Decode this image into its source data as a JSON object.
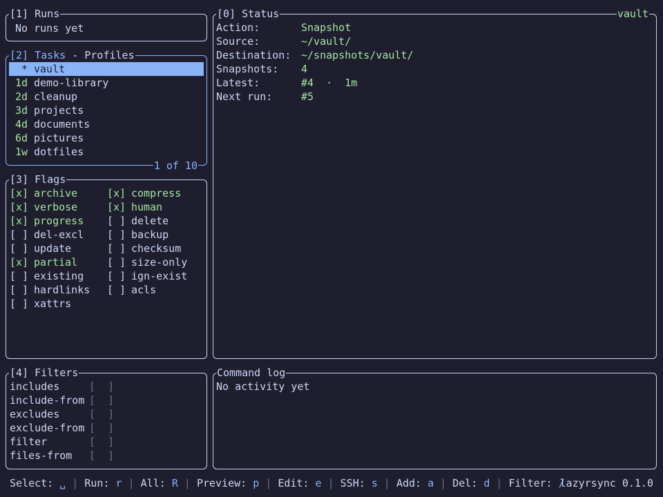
{
  "runs": {
    "title_num": "[1]",
    "title": " Runs",
    "empty": "No runs yet"
  },
  "tasks": {
    "title_num": "[2]",
    "title": " Tasks",
    "subtitle": " - Profiles",
    "items": [
      {
        "marker": "*",
        "name": "vault",
        "selected": true
      },
      {
        "marker": "1d",
        "name": "demo-library"
      },
      {
        "marker": "2d",
        "name": "cleanup"
      },
      {
        "marker": "3d",
        "name": "projects"
      },
      {
        "marker": "4d",
        "name": "documents"
      },
      {
        "marker": "6d",
        "name": "pictures"
      },
      {
        "marker": "1w",
        "name": "dotfiles"
      }
    ],
    "position": "1 of 10"
  },
  "flags": {
    "title_num": "[3]",
    "title": " Flags",
    "on_box": "[x]",
    "off_box": "[ ]",
    "rows": [
      [
        {
          "name": "archive",
          "on": true
        },
        {
          "name": "compress",
          "on": true
        }
      ],
      [
        {
          "name": "verbose",
          "on": true
        },
        {
          "name": "human",
          "on": true
        }
      ],
      [
        {
          "name": "progress",
          "on": true
        },
        {
          "name": "delete",
          "on": false
        }
      ],
      [
        {
          "name": "del-excl",
          "on": false
        },
        {
          "name": "backup",
          "on": false
        }
      ],
      [
        {
          "name": "update",
          "on": false
        },
        {
          "name": "checksum",
          "on": false
        }
      ],
      [
        {
          "name": "partial",
          "on": true
        },
        {
          "name": "size-only",
          "on": false
        }
      ],
      [
        {
          "name": "existing",
          "on": false
        },
        {
          "name": "ign-exist",
          "on": false
        }
      ],
      [
        {
          "name": "hardlinks",
          "on": false
        },
        {
          "name": "acls",
          "on": false
        }
      ],
      [
        {
          "name": "xattrs",
          "on": false
        }
      ]
    ]
  },
  "status": {
    "title": "[0] Status",
    "profile": "vault",
    "rows": [
      {
        "key": "Action:",
        "value": "Snapshot"
      },
      {
        "key": "Source:",
        "value": "~/vault/"
      },
      {
        "key": "Destination:",
        "value": "~/snapshots/vault/"
      },
      {
        "key": "Snapshots:",
        "value": "4"
      },
      {
        "key": "Latest:",
        "value": "#4  ·  1m"
      },
      {
        "key": "Next run:",
        "value": "#5"
      }
    ]
  },
  "filters": {
    "title": "[4] Filters",
    "empty_box": "[  ]",
    "items": [
      "includes",
      "include-from",
      "excludes",
      "exclude-from",
      "filter",
      "files-from"
    ]
  },
  "cmdlog": {
    "title": "Command log",
    "empty": "No activity yet"
  },
  "footer": {
    "hints": [
      {
        "label": "Select: ",
        "key": "␣"
      },
      {
        "label": "Run: ",
        "key": "r"
      },
      {
        "label": "All: ",
        "key": "R"
      },
      {
        "label": "Preview: ",
        "key": "p"
      },
      {
        "label": "Edit: ",
        "key": "e"
      },
      {
        "label": "SSH: ",
        "key": "s"
      },
      {
        "label": "Add: ",
        "key": "a"
      },
      {
        "label": "Del: ",
        "key": "d"
      },
      {
        "label": "Filter: ",
        "key": "/"
      }
    ],
    "separator": " | ",
    "version": "lazyrsync 0.1.0"
  },
  "colors": {
    "background": "#1e1e2e",
    "text": "#cdd6f4",
    "accent": "#89b4fa",
    "green": "#a6e3a1",
    "muted": "#6c7086"
  }
}
